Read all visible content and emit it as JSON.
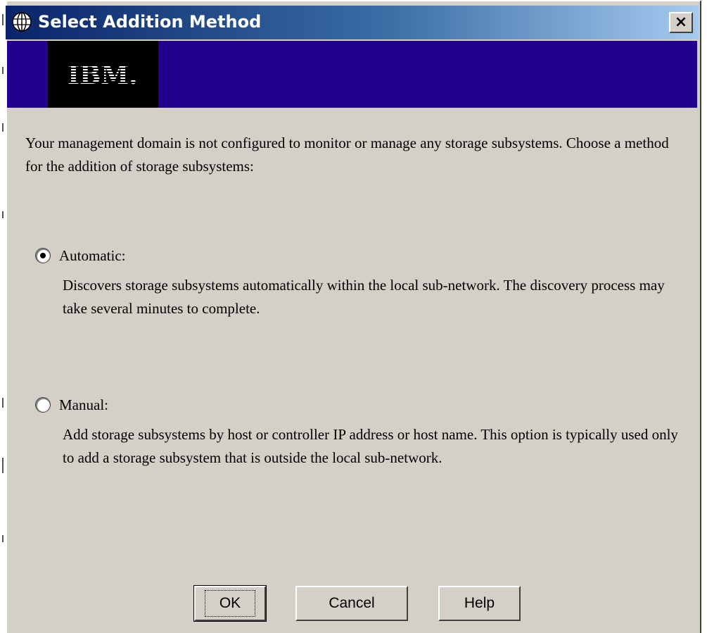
{
  "window": {
    "title": "Select Addition Method",
    "icon": "globe-icon",
    "close_label": "×",
    "title_bar_color": "#0a246a",
    "banner_color": "#240090",
    "logo_text": "IBM."
  },
  "intro_text": "Your management domain is not configured to monitor or manage any storage subsystems. Choose a method for the addition of storage subsystems:",
  "options": [
    {
      "label": "Automatic:",
      "selected": true,
      "description": "Discovers storage subsystems automatically within the local sub-network. The discovery process may take several minutes to complete."
    },
    {
      "label": "Manual:",
      "selected": false,
      "description": "Add storage subsystems by host or controller IP address or host name. This option is typically used only to add a storage subsystem that is outside the local sub-network."
    }
  ],
  "buttons": {
    "ok": "OK",
    "cancel": "Cancel",
    "help": "Help"
  }
}
